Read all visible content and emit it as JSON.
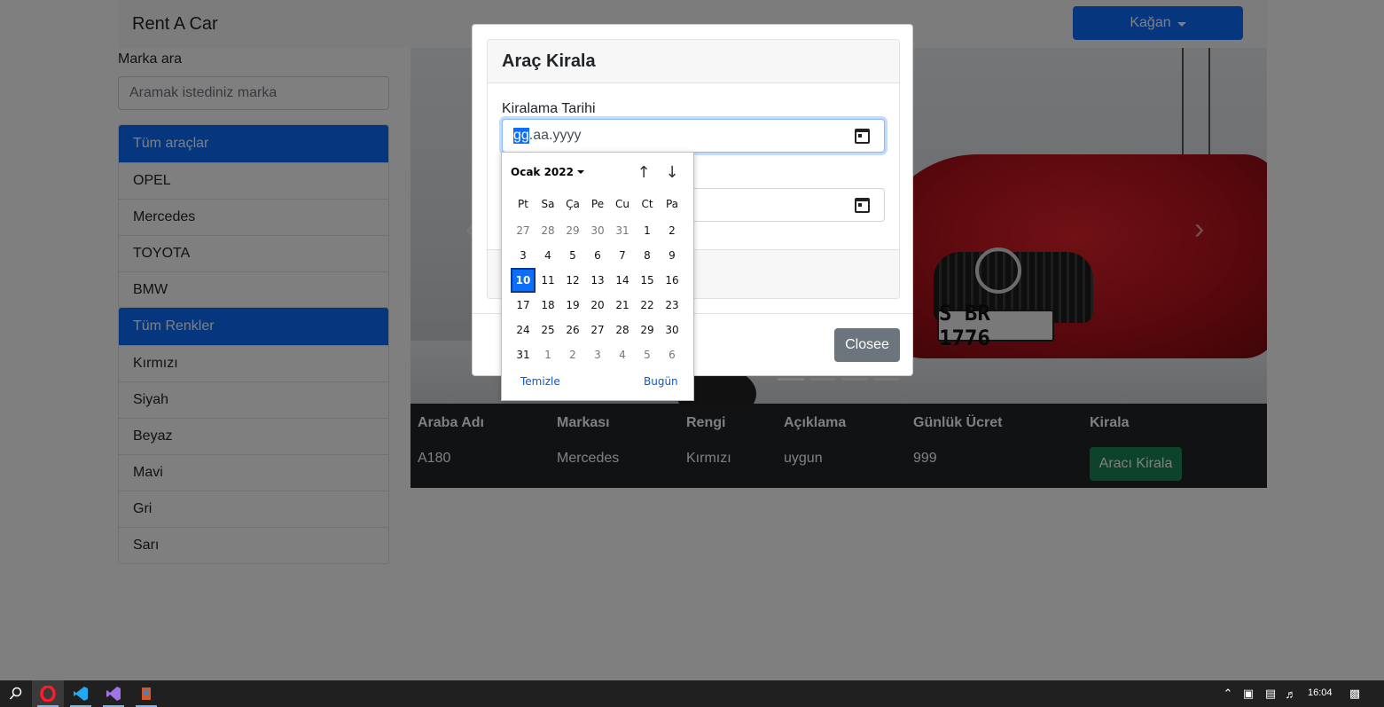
{
  "navbar": {
    "brand": "Rent A Car",
    "user_menu": "Kağan"
  },
  "search": {
    "label": "Marka ara",
    "placeholder": "Aramak istediniz marka"
  },
  "brands": {
    "items": [
      {
        "label": "Tüm araçlar",
        "active": true
      },
      {
        "label": "OPEL"
      },
      {
        "label": "Mercedes"
      },
      {
        "label": "TOYOTA"
      },
      {
        "label": "BMW"
      }
    ]
  },
  "colors": {
    "items": [
      {
        "label": "Tüm Renkler",
        "active": true
      },
      {
        "label": "Kırmızı"
      },
      {
        "label": "Siyah"
      },
      {
        "label": "Beyaz"
      },
      {
        "label": "Mavi"
      },
      {
        "label": "Gri"
      },
      {
        "label": "Sarı"
      }
    ]
  },
  "carousel": {
    "plate_text": "S BR 1776",
    "prev_icon": "‹",
    "next_icon": "›"
  },
  "table": {
    "headers": [
      "Araba Adı",
      "Markası",
      "Rengi",
      "Açıklama",
      "Günlük Ücret",
      "Kirala"
    ],
    "rows": [
      {
        "name": "A180",
        "brand": "Mercedes",
        "color": "Kırmızı",
        "description": "uygun",
        "daily_price": "999",
        "action": "Aracı Kirala"
      }
    ]
  },
  "modal": {
    "title": "Araç Kirala",
    "rent_date_label": "Kiralama Tarihi",
    "date_input": {
      "seg_day": "gg",
      "rest": ".aa.yyyy"
    },
    "close_button": "Closee"
  },
  "datepicker": {
    "month_label": "Ocak 2022",
    "weekdays": [
      "Pt",
      "Sa",
      "Ça",
      "Pe",
      "Cu",
      "Ct",
      "Pa"
    ],
    "weeks": [
      [
        "27",
        "28",
        "29",
        "30",
        "31",
        "1",
        "2"
      ],
      [
        "3",
        "4",
        "5",
        "6",
        "7",
        "8",
        "9"
      ],
      [
        "10",
        "11",
        "12",
        "13",
        "14",
        "15",
        "16"
      ],
      [
        "17",
        "18",
        "19",
        "20",
        "21",
        "22",
        "23"
      ],
      [
        "24",
        "25",
        "26",
        "27",
        "28",
        "29",
        "30"
      ],
      [
        "31",
        "1",
        "2",
        "3",
        "4",
        "5",
        "6"
      ]
    ],
    "today": "10",
    "clear_label": "Temizle",
    "today_label": "Bugün"
  },
  "taskbar": {
    "clock": "16:04"
  },
  "theme": {
    "primary": "#0d6efd",
    "success": "#198754",
    "secondary": "#6c757d",
    "dark": "#212529"
  }
}
